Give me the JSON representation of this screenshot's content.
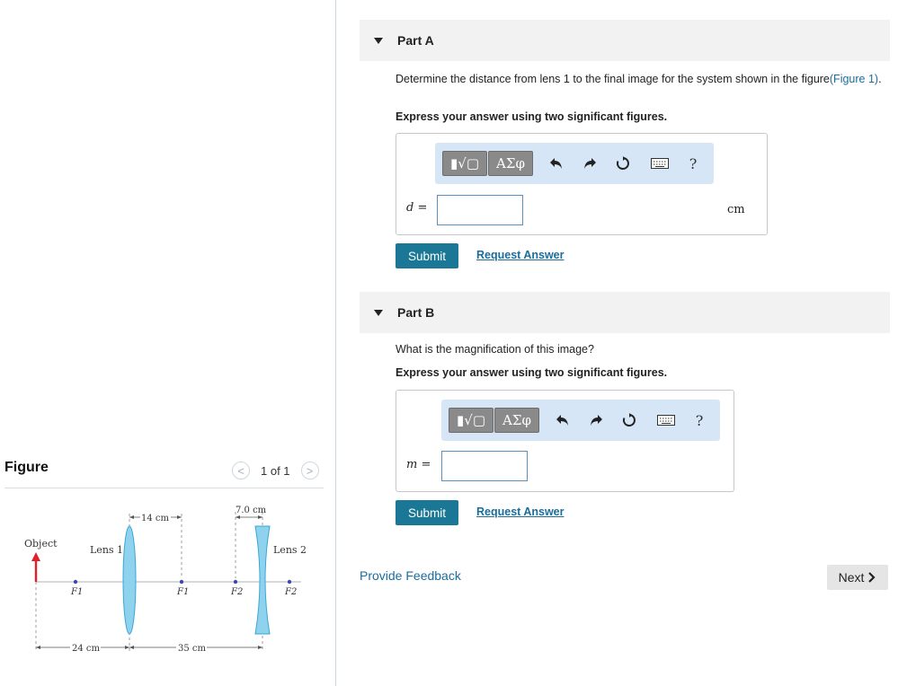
{
  "figure": {
    "title": "Figure",
    "pager": {
      "prev": "<",
      "text": "1 of 1",
      "next": ">"
    },
    "labels": {
      "object": "Object",
      "lens1": "Lens 1",
      "lens2": "Lens 2",
      "f1_left": "F1",
      "f1_right": "F1",
      "f2_left": "F2",
      "f2_right": "F2",
      "dim_14": "14 cm",
      "dim_7": "7.0 cm",
      "dim_24": "24 cm",
      "dim_35": "35 cm"
    }
  },
  "partA": {
    "title": "Part A",
    "question": "Determine the distance from lens 1 to the final image for the system shown in the figure",
    "question_link": "(Figure 1)",
    "question_end": ".",
    "instruction": "Express your answer using two significant figures.",
    "toolbar": {
      "templates": "▮√▢",
      "greek": "ΑΣφ",
      "help": "?"
    },
    "variable": "d =",
    "input_value": "",
    "unit": "cm",
    "submit": "Submit",
    "request": "Request Answer"
  },
  "partB": {
    "title": "Part B",
    "question": "What is the magnification of this image?",
    "instruction": "Express your answer using two significant figures.",
    "toolbar": {
      "templates": "▮√▢",
      "greek": "ΑΣφ",
      "help": "?"
    },
    "variable": "m =",
    "input_value": "",
    "submit": "Submit",
    "request": "Request Answer"
  },
  "footer": {
    "feedback": "Provide Feedback",
    "next": "Next"
  },
  "colors": {
    "accent": "#1a7896",
    "link": "#1a6d9c",
    "lens": "#8ed2ee",
    "object": "#e3202a"
  }
}
